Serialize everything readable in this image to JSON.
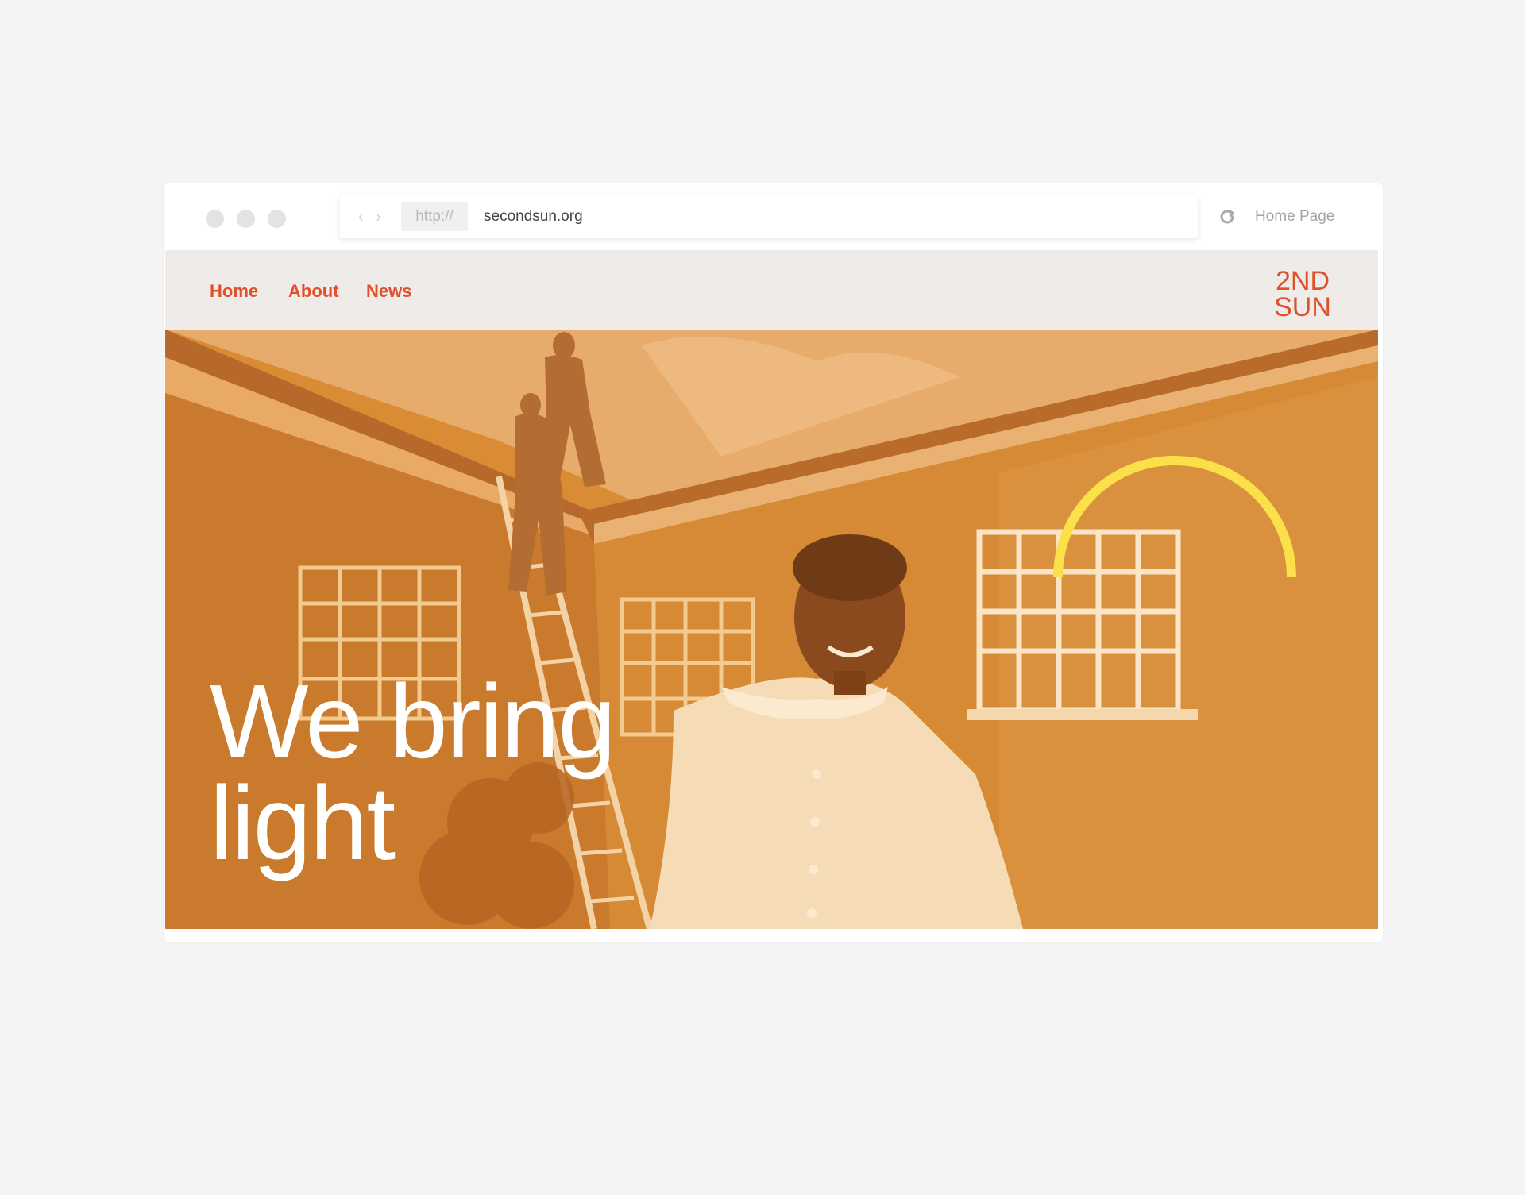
{
  "browser": {
    "protocol": "http://",
    "url": "secondsun.org",
    "home_label": "Home Page",
    "icons": [
      "back-icon",
      "forward-icon",
      "reload-icon"
    ]
  },
  "site": {
    "nav": [
      {
        "label": "Home"
      },
      {
        "label": "About"
      },
      {
        "label": "News"
      }
    ],
    "logo": {
      "line1": "2ND",
      "line2": "SUN"
    },
    "hero": {
      "headline": "We bring\nlight"
    }
  },
  "colors": {
    "accent": "#e0502a",
    "hero_tint": "#d98c33",
    "sun_arc": "#fbe04a",
    "nav_bg": "#efebe8"
  }
}
